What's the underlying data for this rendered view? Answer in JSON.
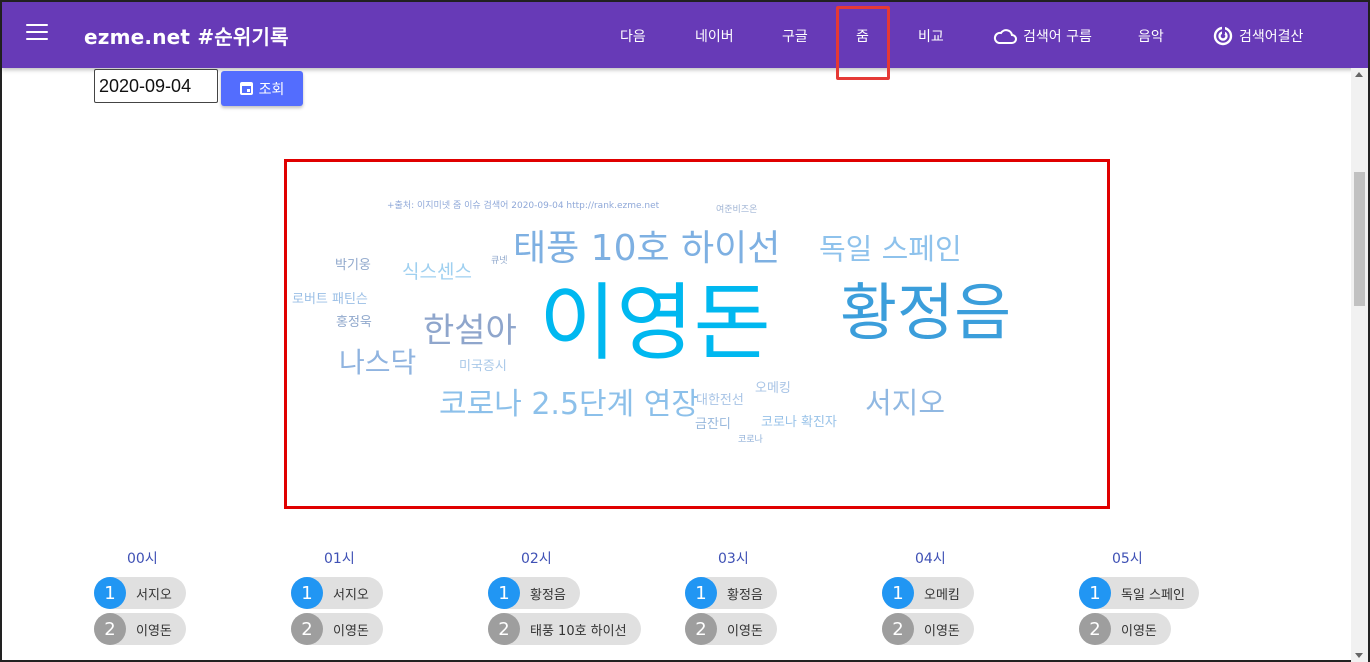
{
  "header": {
    "title": "ezme.net #순위기록",
    "nav": [
      {
        "label": "다음"
      },
      {
        "label": "네이버"
      },
      {
        "label": "구글"
      },
      {
        "label": "줌"
      },
      {
        "label": "비교"
      },
      {
        "label": "검색어 구름"
      },
      {
        "label": "음악"
      },
      {
        "label": "검색어결산"
      }
    ]
  },
  "toolbar": {
    "date_value": "2020-09-04",
    "search_label": "조회"
  },
  "wordcloud": {
    "source": "+출처: 이지미넷 줌 이슈 검색어 2020-09-04 http://rank.ezme.net",
    "words": [
      {
        "text": "이영돈",
        "color": "#00b8f0"
      },
      {
        "text": "황정음",
        "color": "#3b9edb"
      },
      {
        "text": "태풍 10호 하이선",
        "color": "#7eb0e2"
      },
      {
        "text": "독일 스페인",
        "color": "#8ec2ec"
      },
      {
        "text": "한설아",
        "color": "#8fa6cc"
      },
      {
        "text": "나스닥",
        "color": "#90b4e0"
      },
      {
        "text": "코로나 2.5단계 연장",
        "color": "#8cc0ea"
      },
      {
        "text": "서지오",
        "color": "#90b8e2"
      },
      {
        "text": "식스센스",
        "color": "#9fd0f0"
      },
      {
        "text": "박기웅",
        "color": "#90a8cc"
      },
      {
        "text": "로버트 패틴슨",
        "color": "#9bbfe6"
      },
      {
        "text": "홍정욱",
        "color": "#90a8cc"
      },
      {
        "text": "미국증시",
        "color": "#a8c8e8"
      },
      {
        "text": "대한전선",
        "color": "#a8c4e6"
      },
      {
        "text": "오메킹",
        "color": "#a8c4e6"
      },
      {
        "text": "금잔디",
        "color": "#98b8dc"
      },
      {
        "text": "코로나 확진자",
        "color": "#98c2e8"
      },
      {
        "text": "코로나",
        "color": "#90b0d8"
      },
      {
        "text": "큐넷",
        "color": "#90a8cc"
      },
      {
        "text": "여준비즈온",
        "color": "#a0b4d4"
      }
    ]
  },
  "hourly": [
    {
      "hour": "00시",
      "items": [
        {
          "rank": "1",
          "word": "서지오"
        },
        {
          "rank": "2",
          "word": "이영돈"
        }
      ]
    },
    {
      "hour": "01시",
      "items": [
        {
          "rank": "1",
          "word": "서지오"
        },
        {
          "rank": "2",
          "word": "이영돈"
        }
      ]
    },
    {
      "hour": "02시",
      "items": [
        {
          "rank": "1",
          "word": "황정음"
        },
        {
          "rank": "2",
          "word": "태풍 10호 하이선"
        }
      ]
    },
    {
      "hour": "03시",
      "items": [
        {
          "rank": "1",
          "word": "황정음"
        },
        {
          "rank": "2",
          "word": "이영돈"
        }
      ]
    },
    {
      "hour": "04시",
      "items": [
        {
          "rank": "1",
          "word": "오메킴"
        },
        {
          "rank": "2",
          "word": "이영돈"
        }
      ]
    },
    {
      "hour": "05시",
      "items": [
        {
          "rank": "1",
          "word": "독일 스페인"
        },
        {
          "rank": "2",
          "word": "이영돈"
        }
      ]
    }
  ],
  "colors": {
    "header_bg": "#673ab7",
    "button_bg": "#536dfe",
    "rank1": "#2196f3",
    "rank2": "#9e9e9e",
    "highlight": "#e00000"
  }
}
